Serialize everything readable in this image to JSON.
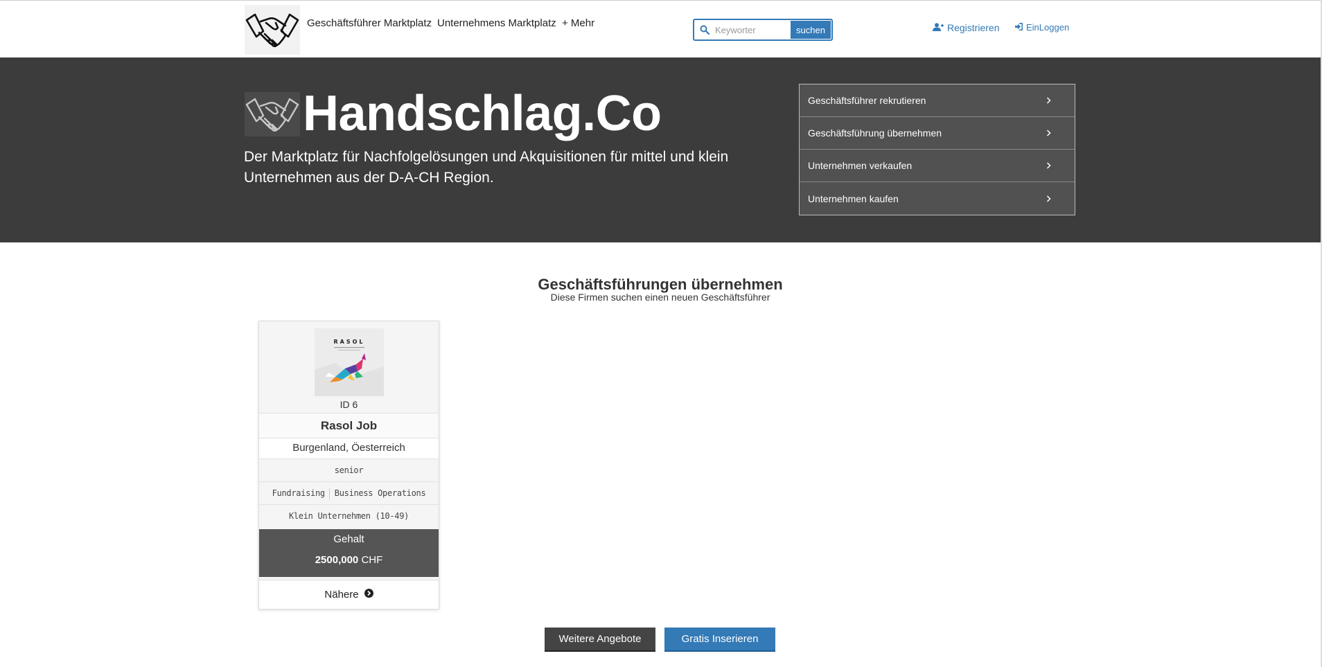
{
  "nav": {
    "links": [
      "Geschäftsführer Marktplatz",
      "Unternehmens Marktplatz",
      "+ Mehr"
    ],
    "search": {
      "placeholder": "Keyworter",
      "button_label": "suchen"
    },
    "register_label": "Registrieren",
    "login_label": "EinLoggen"
  },
  "hero": {
    "title": "Handschlag.Co",
    "subtitle": "Der Marktplatz für Nachfolgelösungen und Akquisitionen für mittel und klein Unternehmen aus der D-A-CH Region.",
    "menu": [
      "Geschäftsführer rekrutieren",
      "Geschäftsführung übernehmen",
      "Unternehmen verkaufen",
      "Unternehmen kaufen"
    ]
  },
  "section": {
    "title": "Geschäftsführungen übernehmen",
    "subtitle": "Diese Firmen suchen einen neuen Geschäftsführer"
  },
  "card": {
    "image_brand": "RASOL",
    "id": "ID 6",
    "name": "Rasol Job",
    "location": "Burgenland, Öesterreich",
    "level": "senior",
    "tags": [
      "Fundraising",
      "Business Operations"
    ],
    "company_size": "Klein Unternehmen (10-49)",
    "salary_label": "Gehalt",
    "salary_amount": "2500,000",
    "salary_currency": "CHF",
    "more_label": "Nähere"
  },
  "buttons": {
    "more_offers": "Weitere Angebote",
    "insert_free": "Gratis Inserieren"
  },
  "colors": {
    "accent": "#337ab7",
    "hero_bg": "#3c3c3c",
    "salary_bg": "#555555"
  }
}
